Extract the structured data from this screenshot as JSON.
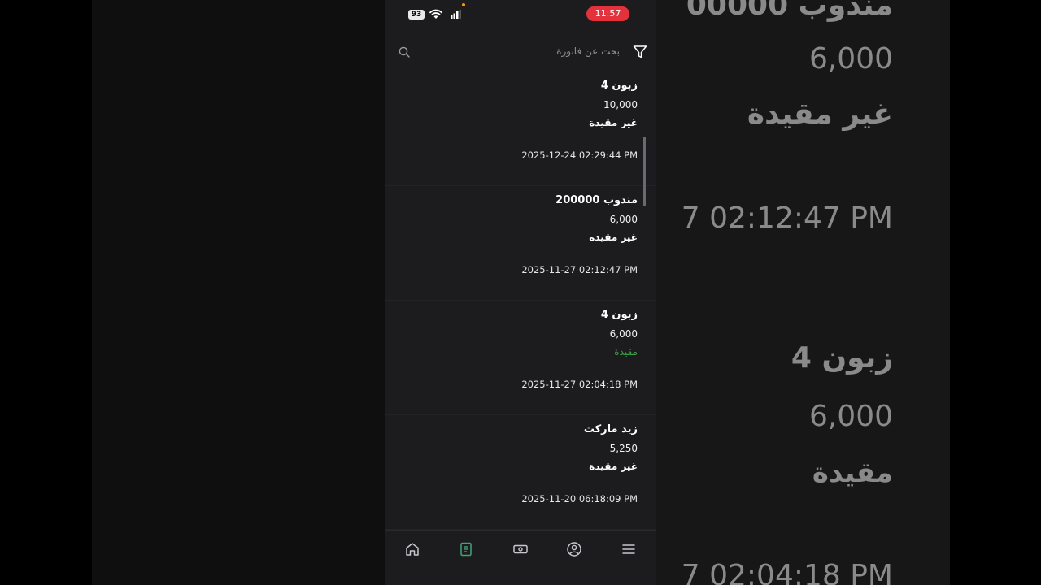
{
  "status_bar": {
    "battery": "93",
    "time": "11:57"
  },
  "search": {
    "placeholder": "بحث عن فاتورة"
  },
  "invoices": [
    {
      "name": "زبون 4",
      "amount": "10,000",
      "status": "غير مقيدة",
      "date": "2025-12-24 02:29:44 PM"
    },
    {
      "name": "مندوب 200000",
      "amount": "6,000",
      "status": "غير مقيدة",
      "date": "2025-11-27 02:12:47 PM"
    },
    {
      "name": "زبون 4",
      "amount": "6,000",
      "status": "مقيدة",
      "date": "2025-11-27 02:04:18 PM"
    },
    {
      "name": "زيد ماركت",
      "amount": "5,250",
      "status": "غير مقيدة",
      "date": "2025-11-20 06:18:09 PM"
    }
  ],
  "background_right": {
    "name_top": "مندوب 00000",
    "amount_top": "6,000",
    "status_top": "غير مقيدة",
    "date_top": "7 02:12:47 PM",
    "name_mid": "زبون 4",
    "amount_mid": "6,000",
    "status_mid": "مقيدة",
    "date_bottom": "7 02:04:18 PM"
  },
  "nav": {
    "items": [
      "home-icon",
      "invoice-icon",
      "cash-icon",
      "profile-icon",
      "menu-icon"
    ],
    "active_index": 1
  },
  "colors": {
    "accent": "#3fa37a",
    "paid": "#3fa34d",
    "time_pill": "#e3323b",
    "surface": "#1c1c1e"
  }
}
